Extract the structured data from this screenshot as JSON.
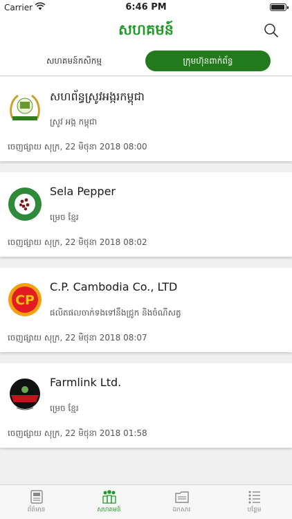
{
  "status_bar": {
    "carrier": "Carrier",
    "time": "6:46 PM"
  },
  "header": {
    "title": "សហគមន៍"
  },
  "segments": [
    {
      "label": "សហគមន៍កសិកម្ម",
      "active": false
    },
    {
      "label": "ក្រុមហ៊ុនពាក់ព័ន្ធ",
      "active": true
    }
  ],
  "items": [
    {
      "name": "សហព័ន្ធស្រូវអង្ករកម្ពុជា",
      "subtitle": "ស្រូវ អង្ក កម្ពុជា",
      "published": "ចេញផ្សាយ សុក្រ, 22 មិថុនា 2018 08:00",
      "logo_text": "CAMBODIA RICE FEDERATION"
    },
    {
      "name": "Sela Pepper",
      "subtitle": "ម្រេច ខ្មែរ",
      "published": "ចេញផ្សាយ សុក្រ, 22 មិថុនា 2018 08:02",
      "logo_text": "SELA PEPPER CAMBODIA"
    },
    {
      "name": "C.P. Cambodia Co., LTD",
      "subtitle": "ផលិតផលចាក់ទងទៅនឹងជ្រូក និងចំណីសត្វ",
      "published": "ចេញផ្សាយ សុក្រ, 22 មិថុនា 2018 08:07",
      "logo_text": "CP"
    },
    {
      "name": "Farmlink Ltd.",
      "subtitle": "ម្រេច ខ្មែរ",
      "published": "ចេញផ្សាយ សុក្រ, 22 មិថុនា 2018 01:58",
      "logo_text": "KAMPOT PEPPER The taste of heritage"
    }
  ],
  "tabs": [
    {
      "label": "ព័ត៌មាន",
      "icon": "news-icon",
      "active": false
    },
    {
      "label": "សហគមន៍",
      "icon": "community-icon",
      "active": true
    },
    {
      "label": "ឯកសារ",
      "icon": "documents-icon",
      "active": false
    },
    {
      "label": "បន្ថែម",
      "icon": "more-icon",
      "active": false
    }
  ],
  "colors": {
    "brand_green": "#1f9a2a",
    "active_segment": "#227a1c",
    "background": "#f0f0f0"
  }
}
